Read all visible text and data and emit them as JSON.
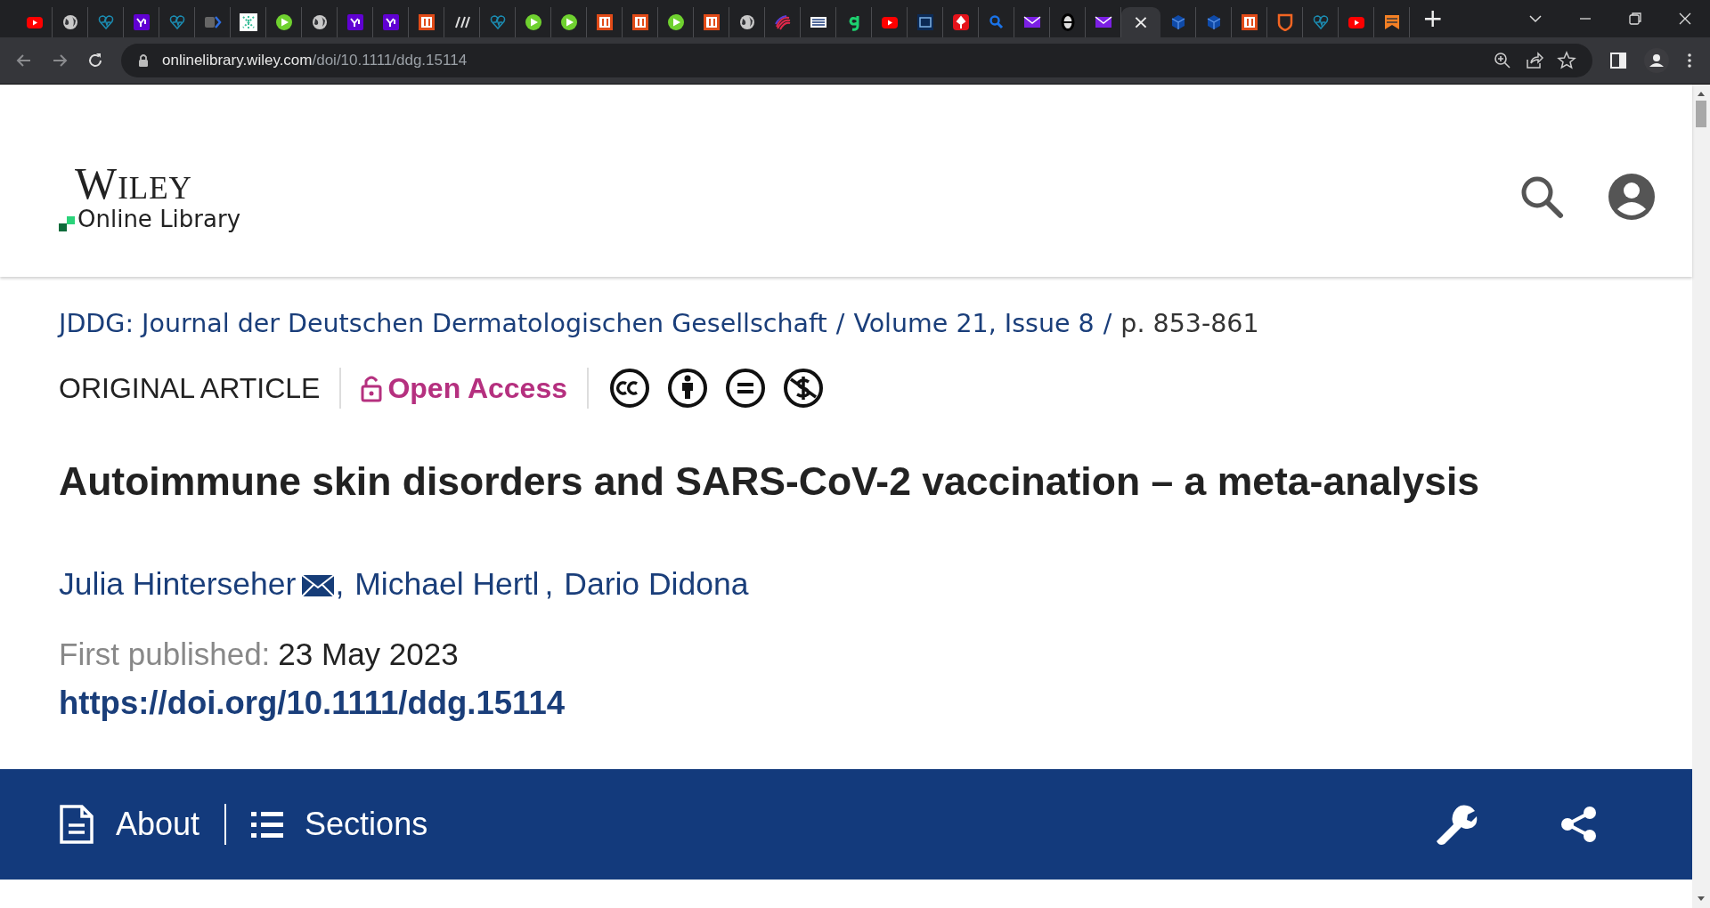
{
  "browser": {
    "tabs": [
      {
        "kind": "youtube",
        "selected": false
      },
      {
        "kind": "globe",
        "selected": false
      },
      {
        "kind": "heart",
        "selected": false
      },
      {
        "kind": "yahoo",
        "selected": false
      },
      {
        "kind": "heart",
        "selected": false
      },
      {
        "kind": "chevron",
        "selected": false
      },
      {
        "kind": "grid",
        "selected": false
      },
      {
        "kind": "play",
        "selected": false
      },
      {
        "kind": "globe",
        "selected": false
      },
      {
        "kind": "yahoo",
        "selected": false
      },
      {
        "kind": "yahoo",
        "selected": false
      },
      {
        "kind": "redsquare",
        "selected": false
      },
      {
        "kind": "slash",
        "selected": false
      },
      {
        "kind": "heart",
        "selected": false
      },
      {
        "kind": "play",
        "selected": false
      },
      {
        "kind": "play",
        "selected": false
      },
      {
        "kind": "redsquare",
        "selected": false
      },
      {
        "kind": "redsquare",
        "selected": false
      },
      {
        "kind": "play",
        "selected": false
      },
      {
        "kind": "redsquare",
        "selected": false
      },
      {
        "kind": "globe",
        "selected": false
      },
      {
        "kind": "stripes",
        "selected": false
      },
      {
        "kind": "news",
        "selected": false
      },
      {
        "kind": "greenhook",
        "selected": false
      },
      {
        "kind": "youtube",
        "selected": false
      },
      {
        "kind": "bluesquare",
        "selected": false
      },
      {
        "kind": "pin",
        "selected": false
      },
      {
        "kind": "search",
        "selected": false
      },
      {
        "kind": "mail",
        "selected": false
      },
      {
        "kind": "theta",
        "selected": false
      },
      {
        "kind": "mail",
        "selected": false
      },
      {
        "selected": true,
        "close": "×"
      },
      {
        "kind": "cube",
        "selected": false
      },
      {
        "kind": "cube",
        "selected": false
      },
      {
        "kind": "redsquare",
        "selected": false
      },
      {
        "kind": "shield",
        "selected": false
      },
      {
        "kind": "heart",
        "selected": false
      },
      {
        "kind": "youtube",
        "selected": false
      },
      {
        "kind": "bookmark",
        "selected": false
      }
    ],
    "new_tab": "+",
    "url": {
      "host": "onlinelibrary.wiley.com",
      "path": "/doi/10.1111/ddg.15114"
    }
  },
  "header": {
    "logo_top": "Wiley",
    "logo_bottom": "Online Library"
  },
  "breadcrumb": {
    "journal": "JDDG: Journal der Deutschen Dermatologischen Gesellschaft",
    "separator": "/",
    "volume": "Volume 21, Issue 8",
    "separator_2": "/",
    "pages": "p. 853-861"
  },
  "article_type": "ORIGINAL ARTICLE",
  "access": "Open Access",
  "title": "Autoimmune skin disorders and SARS-CoV-2 vaccination – a meta-analysis",
  "authors": [
    {
      "name": "Julia Hinterseher",
      "corresponding": true,
      "separator": ","
    },
    {
      "name": "Michael Hertl",
      "corresponding": false,
      "separator": ","
    },
    {
      "name": "Dario Didona",
      "corresponding": false
    }
  ],
  "published": {
    "label": "First published:",
    "date": "23 May 2023"
  },
  "doi": "https://doi.org/10.1111/ddg.15114",
  "toolbar": {
    "about": "About",
    "sections": "Sections"
  }
}
